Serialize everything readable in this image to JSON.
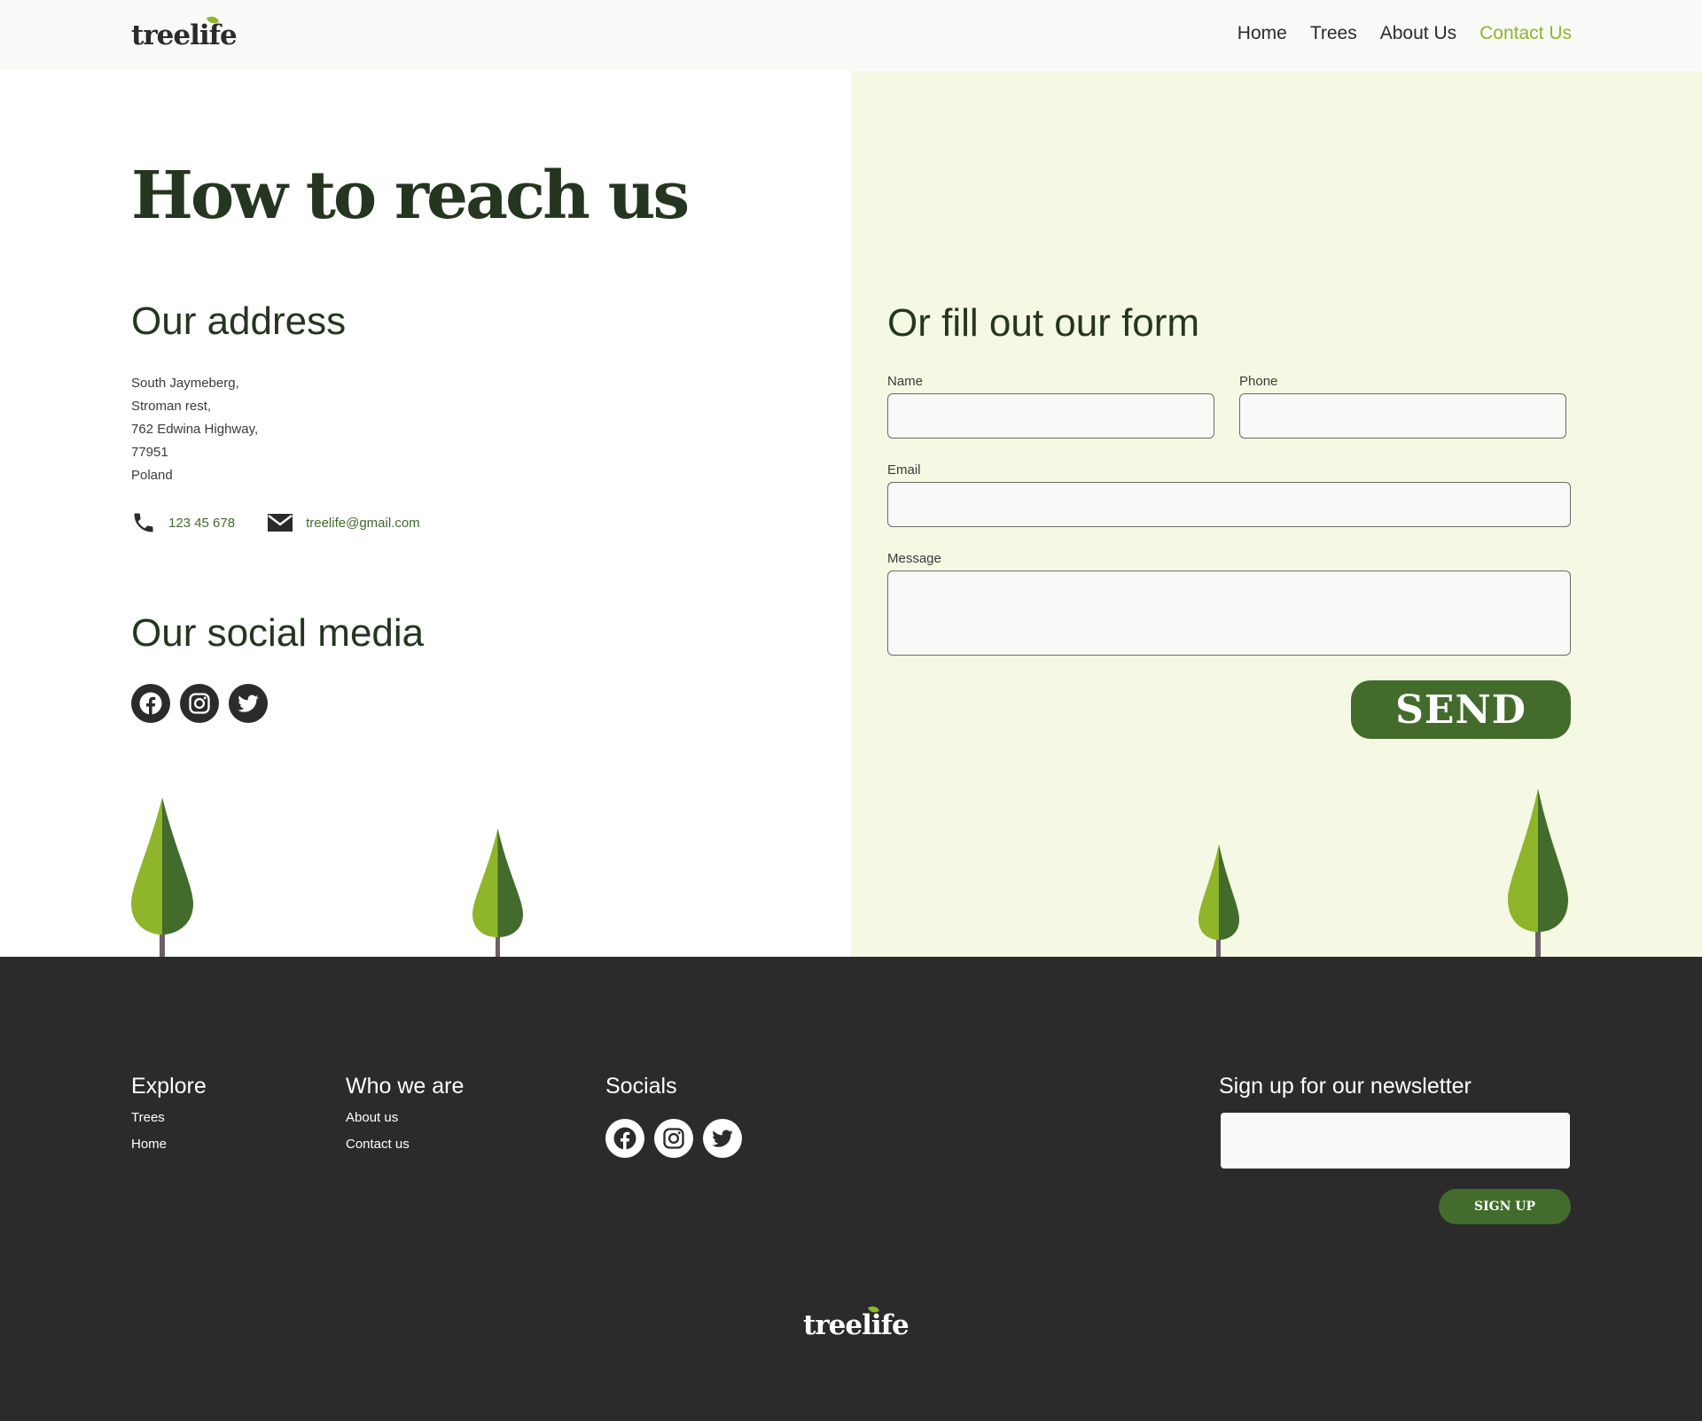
{
  "header": {
    "logo": "treelife",
    "nav": [
      "Home",
      "Trees",
      "About Us",
      "Contact Us"
    ],
    "active": "Contact Us"
  },
  "main": {
    "title": "How to reach us",
    "address_heading": "Our address",
    "address_lines": [
      "South Jaymeberg,",
      "Stroman rest,",
      "762 Edwina Highway,",
      "77951",
      "Poland"
    ],
    "phone": "123 45 678",
    "email": "treelife@gmail.com",
    "social_heading": "Our social media",
    "social_icons": [
      "facebook-icon",
      "instagram-icon",
      "twitter-icon"
    ]
  },
  "form": {
    "heading": "Or fill out our form",
    "name_label": "Name",
    "name_value": "",
    "phone_label": "Phone",
    "phone_value": "",
    "email_label": "Email",
    "email_value": "",
    "message_label": "Message",
    "message_value": "",
    "send_label": "SEND"
  },
  "footer": {
    "explore_heading": "Explore",
    "explore_links": [
      "Trees",
      "Home"
    ],
    "who_heading": "Who we are",
    "who_links": [
      "About us",
      "Contact us"
    ],
    "socials_heading": "Socials",
    "newsletter_heading": "Sign up for our newsletter",
    "newsletter_value": "",
    "signup_label": "SIGN UP",
    "logo": "treelife"
  },
  "colors": {
    "accent_green": "#8fb52a",
    "dark_green": "#436c2c",
    "heading_green": "#253620",
    "form_bg": "#f5f8e3",
    "footer_bg": "#2b2b2b"
  }
}
